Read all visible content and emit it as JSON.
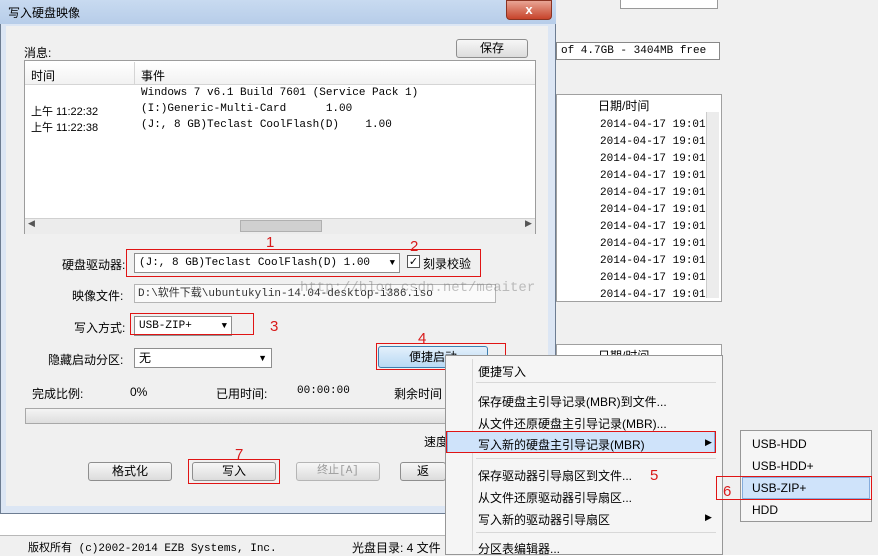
{
  "dialog": {
    "title": "写入硬盘映像",
    "close_label": "x",
    "messages_label": "消息:",
    "save_button": "保存",
    "log_headers": [
      "时间",
      "事件"
    ],
    "log_rows": [
      {
        "time": "",
        "event": "Windows 7 v6.1 Build 7601 (Service Pack 1)"
      },
      {
        "time": "上午 11:22:32",
        "event": "(I:)Generic-Multi-Card      1.00"
      },
      {
        "time": "上午 11:22:38",
        "event": "(J:, 8 GB)Teclast CoolFlash(D)    1.00"
      }
    ],
    "disk_label": "硬盘驱动器:",
    "disk_value": "(J:, 8 GB)Teclast CoolFlash(D)    1.00",
    "verify_label": "刻录校验",
    "image_label": "映像文件:",
    "image_value": "D:\\软件下载\\ubuntukylin-14.04-desktop-i386.iso",
    "write_mode_label": "写入方式:",
    "write_mode_value": "USB-ZIP+",
    "hidden_label": "隐藏启动分区:",
    "hidden_value": "无",
    "quick_boot_button": "便捷启动",
    "progress_label": "完成比例:",
    "progress_value": "0%",
    "elapsed_label": "已用时间:",
    "elapsed_value": "00:00:00",
    "remaining_label": "剩余时间",
    "speed_label": "速度",
    "format_button": "格式化",
    "write_button": "写入",
    "stop_button": "终止[A]",
    "return_button": "返"
  },
  "annotations": [
    "1",
    "2",
    "3",
    "4",
    "5",
    "6",
    "7"
  ],
  "context_menu": {
    "items": [
      "便捷写入",
      "保存硬盘主引导记录(MBR)到文件...",
      "从文件还原硬盘主引导记录(MBR)...",
      "写入新的硬盘主引导记录(MBR)",
      "保存驱动器引导扇区到文件...",
      "从文件还原驱动器引导扇区...",
      "写入新的驱动器引导扇区",
      "分区表编辑器..."
    ],
    "submenu": [
      "USB-HDD",
      "USB-HDD+",
      "USB-ZIP+",
      "HDD"
    ]
  },
  "background": {
    "capacity": "of 4.7GB - 3404MB free",
    "date_header": "日期/时间",
    "dates": [
      "2014-04-17 19:01",
      "2014-04-17 19:01",
      "2014-04-17 19:01",
      "2014-04-17 19:01",
      "2014-04-17 19:01",
      "2014-04-17 19:01",
      "2014-04-17 19:01",
      "2014-04-17 19:01",
      "2014-04-17 19:01",
      "2014-04-17 19:01",
      "2014-04-17 19:01"
    ],
    "date_header2": "日期/时间",
    "watermark": "http://blog.csdn.net/meaiter",
    "copyright": "版权所有 (c)2002-2014 EZB Systems, Inc.",
    "disc_dir": "光盘目录: 4 文件"
  },
  "colors": {
    "accent_red": "#e01414",
    "menu_highlight": "#cfe3fa"
  }
}
